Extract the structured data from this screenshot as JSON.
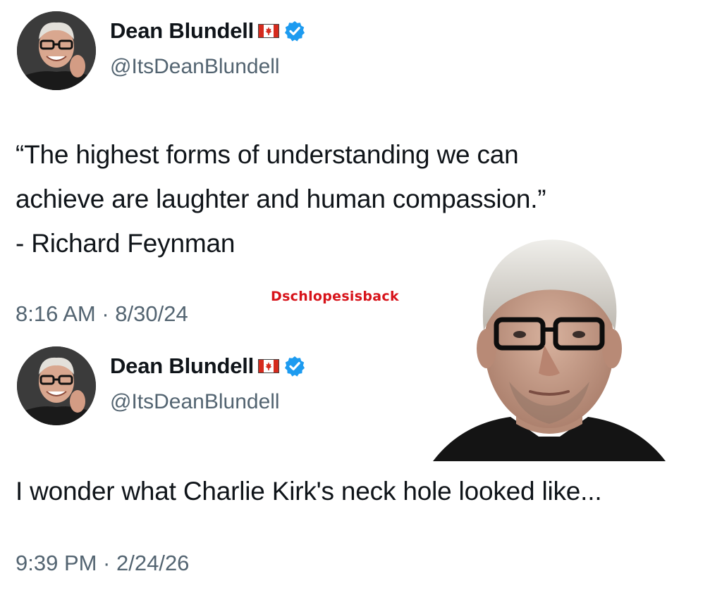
{
  "tweets": [
    {
      "display_name": "Dean Blundell",
      "handle": "@ItsDeanBlundell",
      "text": "“The highest forms of understanding we can\nachieve are laughter and human compassion.”\n- Richard Feynman",
      "timestamp": "8:16 AM · 8/30/24"
    },
    {
      "display_name": "Dean Blundell",
      "handle": "@ItsDeanBlundell",
      "text": "I wonder what Charlie Kirk's neck hole looked like...",
      "timestamp": "9:39 PM · 2/24/26"
    }
  ],
  "watermark": "Dschlopesisback",
  "icons": {
    "flag": "canada-flag-icon",
    "verified": "verified-badge-icon"
  },
  "colors": {
    "verified_blue": "#1d9bf0",
    "secondary_text": "#536471",
    "watermark_red": "#d7131a"
  }
}
